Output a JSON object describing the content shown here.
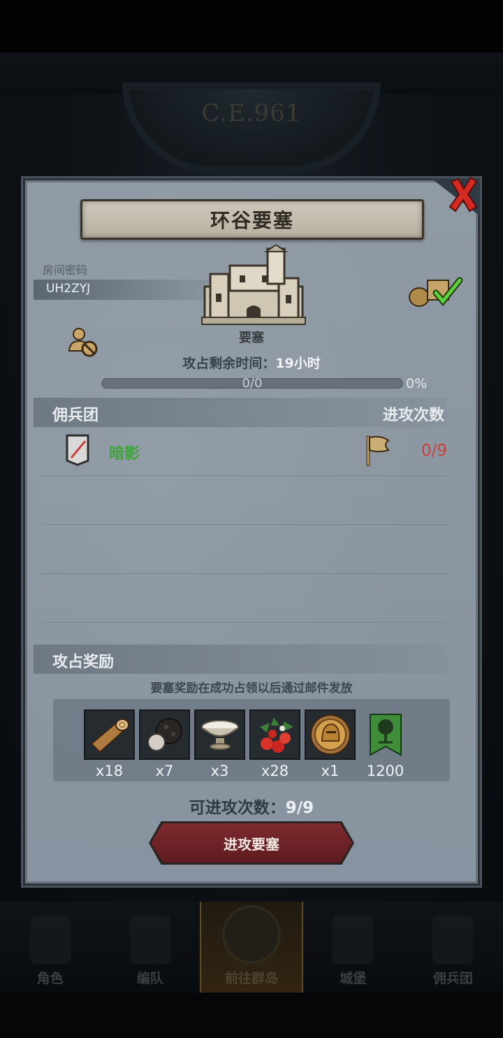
{
  "background": {
    "era": "C.E.961"
  },
  "bottom_nav": [
    {
      "label": "角色",
      "active": false
    },
    {
      "label": "编队",
      "active": false
    },
    {
      "label": "前往群岛",
      "active": true
    },
    {
      "label": "城堡",
      "active": false
    },
    {
      "label": "佣兵团",
      "active": false
    }
  ],
  "dialog": {
    "title": "环谷要塞",
    "room_code_label": "房间密码",
    "room_code": "UH2ZYJ",
    "building_type": "要塞",
    "remaining_label": "攻占剩余时间：",
    "remaining_value": "19小时",
    "progress": {
      "count": "0/0",
      "percent_text": "0%",
      "fraction": 0
    },
    "mercenary_header": "佣兵团",
    "attacks_header": "进攻次数",
    "mercenaries": [
      {
        "name": "暗影",
        "attacks": "0/9"
      }
    ],
    "rewards_header": "攻占奖励",
    "rewards_note": "要塞奖励在成功占领以后通过邮件发放",
    "rewards": [
      {
        "icon": "log-icon",
        "qty": "x18"
      },
      {
        "icon": "truffle-icon",
        "qty": "x7"
      },
      {
        "icon": "milk-bowl-icon",
        "qty": "x3"
      },
      {
        "icon": "berries-icon",
        "qty": "x28"
      },
      {
        "icon": "helmet-coin-icon",
        "qty": "x1"
      },
      {
        "icon": "tree-banner-icon",
        "qty": "1200"
      }
    ],
    "available_attacks_label": "可进攻次数：",
    "available_attacks_value": "9/9",
    "attack_button": "进攻要塞"
  },
  "colors": {
    "panel": "#8b96a1",
    "merc_name": "#3fa43b",
    "attack_count": "#c8413a",
    "button": "#6e2226"
  }
}
